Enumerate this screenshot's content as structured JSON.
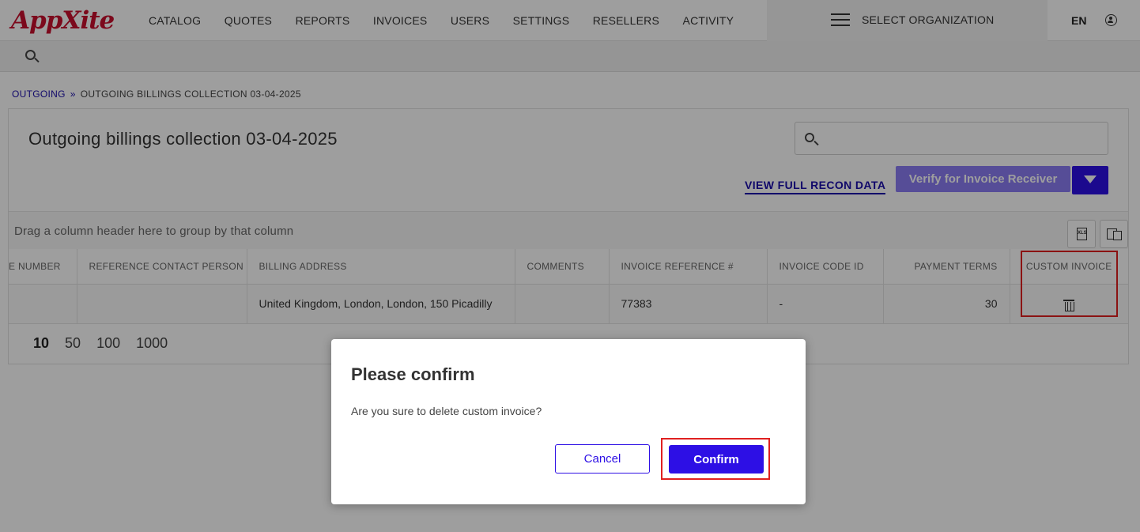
{
  "app": {
    "logo_text": "AppXite"
  },
  "nav": {
    "items": [
      "CATALOG",
      "QUOTES",
      "REPORTS",
      "INVOICES",
      "USERS",
      "SETTINGS",
      "RESELLERS",
      "ACTIVITY"
    ],
    "org_label": "SELECT ORGANIZATION",
    "language": "EN"
  },
  "breadcrumb": {
    "parent": "OUTGOING",
    "separator": "»",
    "current": "OUTGOING BILLINGS COLLECTION 03-04-2025"
  },
  "page": {
    "title": "Outgoing billings collection 03-04-2025",
    "search_placeholder": "",
    "recon_link": "VIEW FULL RECON DATA",
    "verify_button": "Verify for Invoice Receiver"
  },
  "grid": {
    "group_hint": "Drag a column header here to group by that column",
    "columns": [
      "E NUMBER",
      "REFERENCE CONTACT PERSON",
      "BILLING ADDRESS",
      "COMMENTS",
      "INVOICE REFERENCE #",
      "INVOICE CODE ID",
      "PAYMENT TERMS",
      "CUSTOM INVOICE"
    ],
    "rows": [
      {
        "number": "",
        "contact": "",
        "address": "United Kingdom, London, London, 150 Picadilly",
        "comments": "",
        "invoice_ref": "77383",
        "code_id": "-",
        "payment_terms": "30"
      }
    ],
    "page_sizes": [
      "10",
      "50",
      "100",
      "1000"
    ]
  },
  "icons": {
    "search": "search-icon",
    "menu": "hamburger-icon",
    "user": "user-circle-icon",
    "delete": "trash-icon",
    "export": "xlsx-export-icon",
    "columns": "column-chooser-icon"
  },
  "colors": {
    "brand": "#c8102e",
    "primary": "#2d0fe5",
    "highlight": "#e02020"
  },
  "dialog": {
    "title": "Please confirm",
    "message": "Are you sure to delete custom invoice?",
    "cancel": "Cancel",
    "confirm": "Confirm"
  }
}
